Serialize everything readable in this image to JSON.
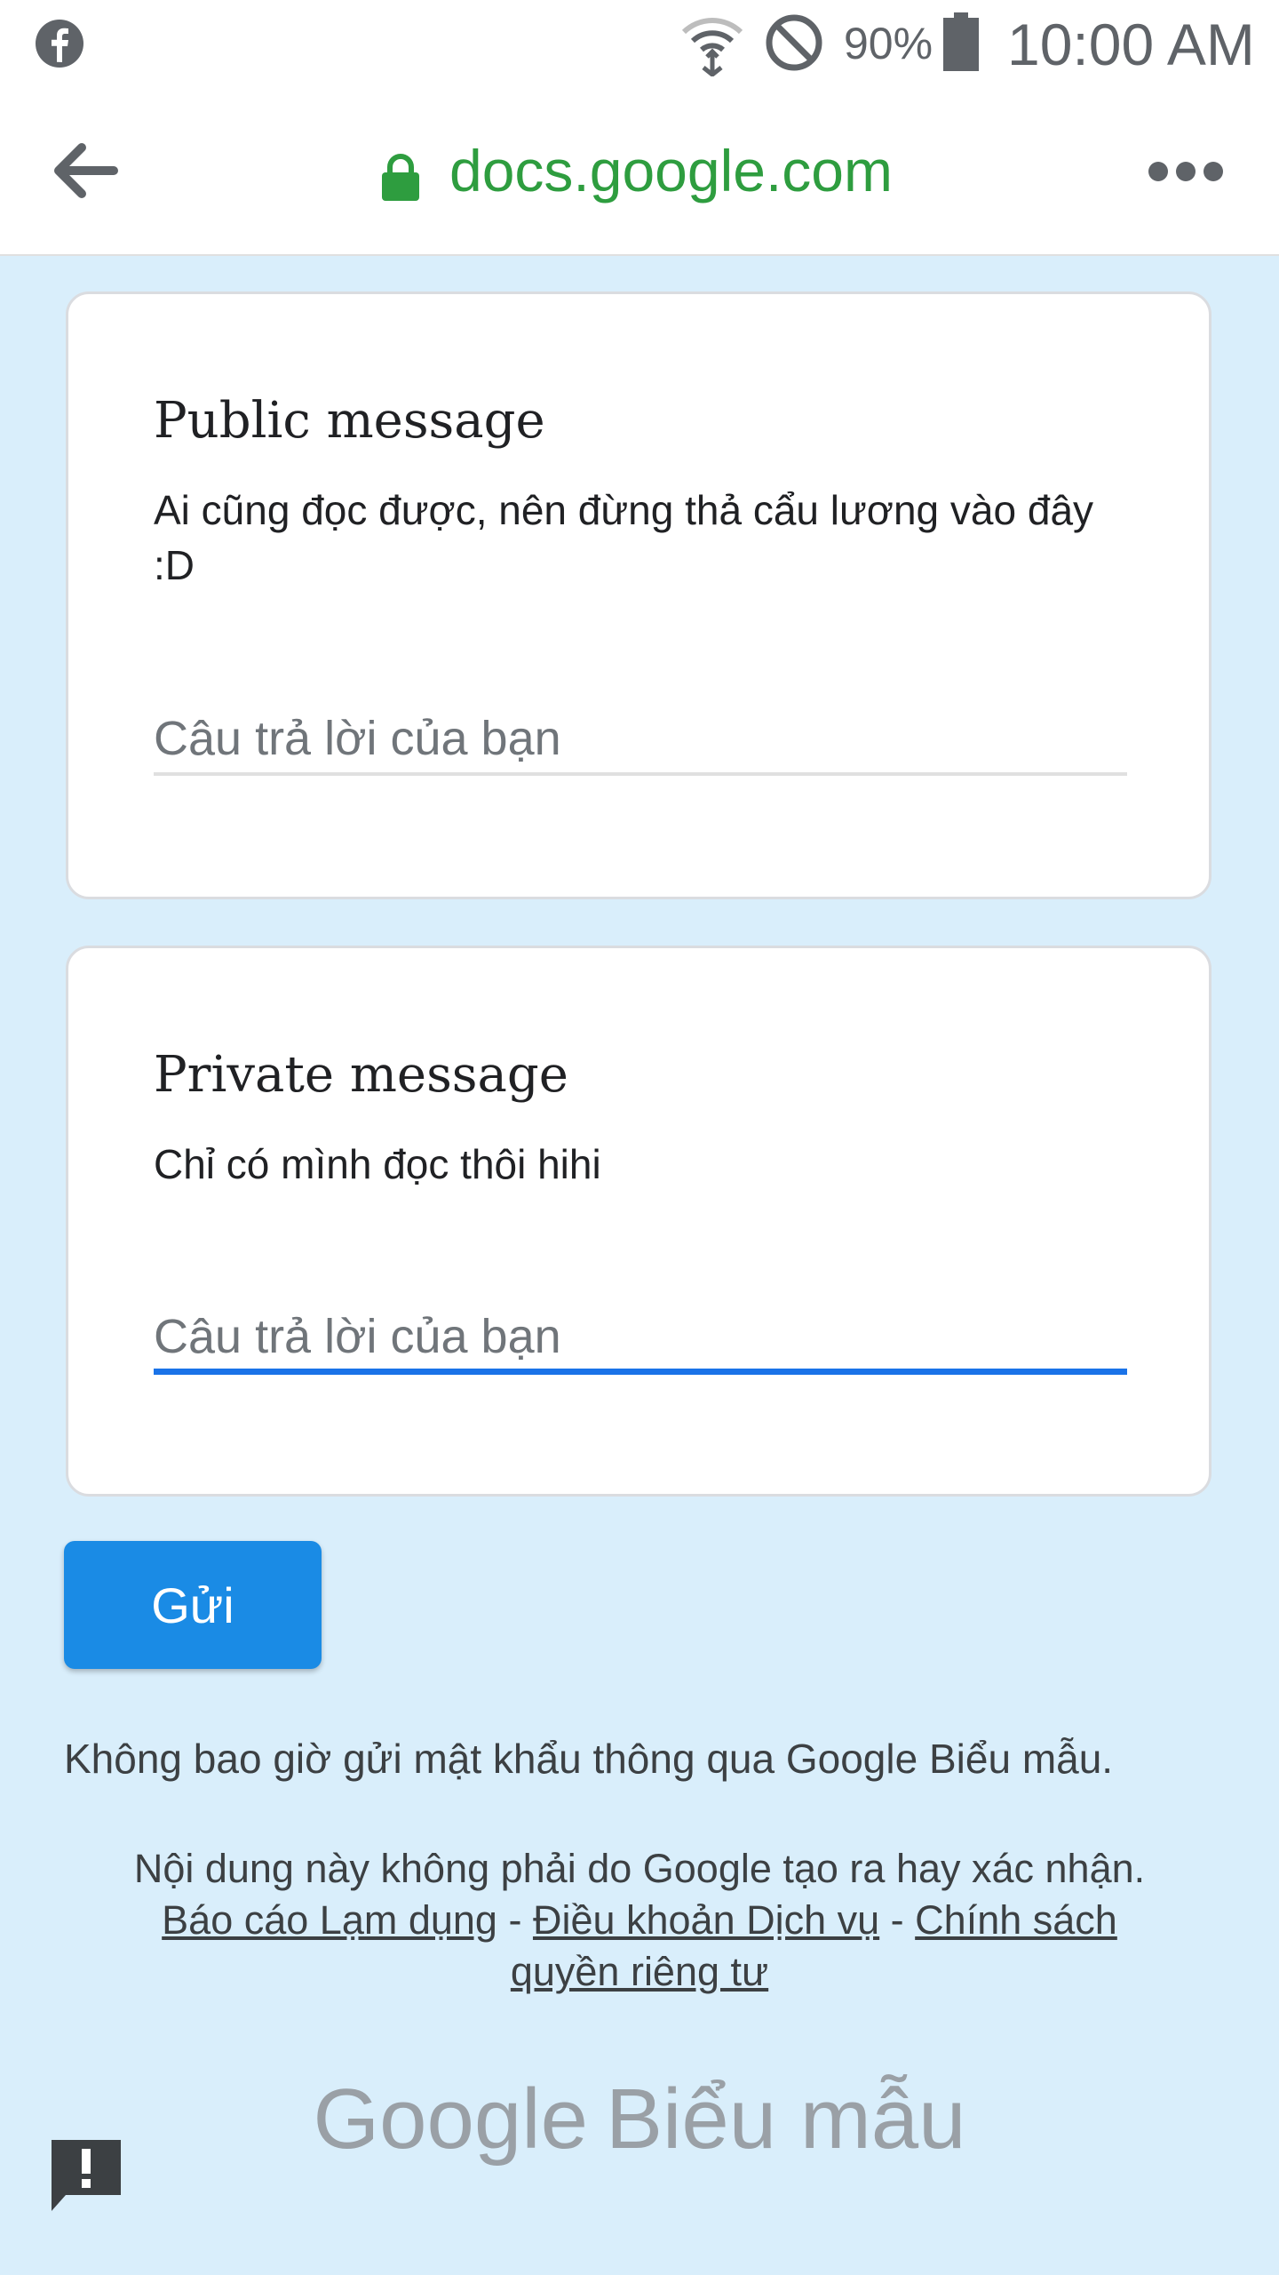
{
  "status_bar": {
    "battery_percent": "90%",
    "time": "10:00 AM"
  },
  "browser": {
    "url": "docs.google.com"
  },
  "form": {
    "questions": [
      {
        "title": "Public message",
        "description": "Ai cũng đọc được, nên đừng thả cẩu lương vào đây :D",
        "placeholder": "Câu trả lời của bạn"
      },
      {
        "title": "Private message",
        "description": "Chỉ có mình đọc thôi hihi",
        "placeholder": "Câu trả lời của bạn"
      }
    ],
    "submit_label": "Gửi",
    "password_notice": "Không bao giờ gửi mật khẩu thông qua Google Biểu mẫu.",
    "footer": {
      "disclaimer": "Nội dung này không phải do Google tạo ra hay xác nhận.",
      "report_abuse": "Báo cáo Lạm dụng",
      "separator": " - ",
      "terms": "Điều khoản Dịch vụ",
      "privacy": "Chính sách quyền riêng tư"
    },
    "brand": {
      "google": "Google",
      "product": "Biểu mẫu"
    }
  },
  "colors": {
    "accent": "#1a73e8",
    "submit_button": "#1a8be5",
    "page_background": "#d9eefb",
    "url_green": "#2e9d3f"
  }
}
